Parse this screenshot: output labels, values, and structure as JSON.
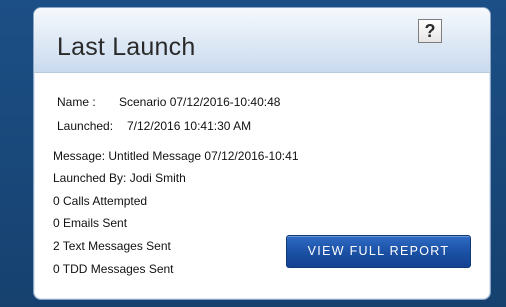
{
  "card": {
    "title": "Last Launch",
    "help_label": "?"
  },
  "launch": {
    "name_label": "Name :",
    "name_value": "Scenario 07/12/2016-10:40:48",
    "launched_label": "Launched:",
    "launched_value": "7/12/2016 10:41:30 AM",
    "message": "Message: Untitled Message 07/12/2016-10:41",
    "launched_by": "Launched By: Jodi Smith",
    "calls_attempted": "0 Calls Attempted",
    "emails_sent": "0 Emails Sent",
    "texts_sent": "2 Text Messages Sent",
    "tdd_sent": "0 TDD Messages Sent"
  },
  "actions": {
    "view_report_label": "VIEW FULL REPORT"
  },
  "colors": {
    "background": "#1a4a7d",
    "button": "#1a4fa3",
    "header_gradient_end": "#c9daef"
  }
}
